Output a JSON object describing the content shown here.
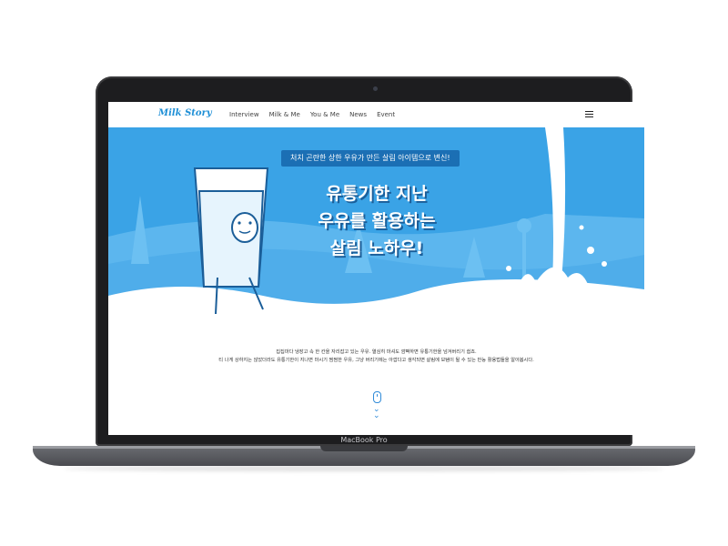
{
  "device": {
    "brand_label": "MacBook Pro"
  },
  "nav": {
    "logo": "Milk Story",
    "items": [
      "Interview",
      "Milk & Me",
      "You & Me",
      "News",
      "Event"
    ]
  },
  "hero": {
    "speech": "처치 곤란한 상한 우유가 만든 살림 아이템으로 변신!",
    "headline_lines": [
      "유통기한 지난",
      "우유를 활용하는",
      "살림 노하우!"
    ]
  },
  "intro": {
    "line1": "집집마다 냉장고 속 한 칸을 자리잡고 있는 우유. 열심히 마셔도 깜빡하면 유통기한을 넘겨버리기 쉽죠.",
    "line2": "티 나게 상하지는 않았더라도 유통기한이 지나면 마시기 찜찜한 우유, 그냥 버리기에는 아깝다고 생각되면 살림에 보탬이 될 수 있는 만능 활용법들을 알아봅시다."
  },
  "colors": {
    "hero_bg": "#3aa3e6",
    "accent": "#1e8fd6",
    "speech_bg": "#1b6fb4"
  }
}
